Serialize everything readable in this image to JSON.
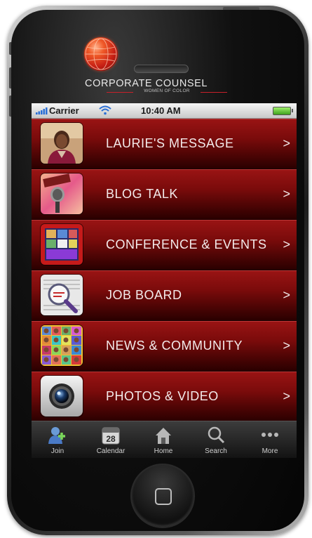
{
  "brand": {
    "title": "CORPORATE COUNSEL",
    "subtitle": "WOMEN OF COLOR",
    "accent": "#c8202a"
  },
  "status_bar": {
    "carrier": "Carrier",
    "time": "10:40 AM",
    "signal_icon": "signal-bars-icon",
    "wifi_icon": "wifi-icon",
    "battery_icon": "battery-icon"
  },
  "menu": {
    "items": [
      {
        "label": "LAURIE'S MESSAGE",
        "icon": "portrait-photo"
      },
      {
        "label": "BLOG TALK",
        "icon": "microphone-photo"
      },
      {
        "label": "CONFERENCE & EVENTS",
        "icon": "events-collage"
      },
      {
        "label": "JOB BOARD",
        "icon": "magnifier-newspaper"
      },
      {
        "label": "NEWS & COMMUNITY",
        "icon": "faces-grid"
      },
      {
        "label": "PHOTOS & VIDEO",
        "icon": "camera-icon"
      }
    ],
    "chevron": ">",
    "row_color": "#7a0b0b"
  },
  "tab_bar": {
    "tabs": [
      {
        "label": "Join",
        "icon": "person-add-icon"
      },
      {
        "label": "Calendar",
        "icon": "calendar-icon",
        "badge": "28"
      },
      {
        "label": "Home",
        "icon": "home-icon"
      },
      {
        "label": "Search",
        "icon": "search-icon"
      },
      {
        "label": "More",
        "icon": "more-icon"
      }
    ]
  }
}
